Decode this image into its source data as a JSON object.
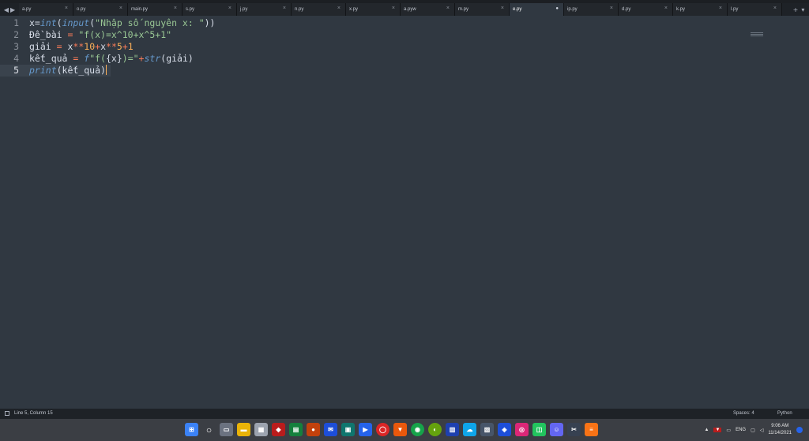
{
  "tabs": [
    {
      "label": "a.py",
      "active": false
    },
    {
      "label": "o.py",
      "active": false
    },
    {
      "label": "main.py",
      "active": false
    },
    {
      "label": "s.py",
      "active": false
    },
    {
      "label": "j.py",
      "active": false
    },
    {
      "label": "n.py",
      "active": false
    },
    {
      "label": "x.py",
      "active": false
    },
    {
      "label": "a.pyw",
      "active": false
    },
    {
      "label": "m.py",
      "active": false
    },
    {
      "label": "e.py",
      "active": true
    },
    {
      "label": "ip.py",
      "active": false
    },
    {
      "label": "d.py",
      "active": false
    },
    {
      "label": "k.py",
      "active": false
    },
    {
      "label": "l.py",
      "active": false
    }
  ],
  "code": {
    "line_numbers": [
      "1",
      "2",
      "3",
      "4",
      "5"
    ],
    "l1": {
      "a": "x=",
      "fn1": "int",
      "b": "(",
      "fn2": "input",
      "c": "(",
      "str": "\"Nhập số nguyên x: \"",
      "d": "))"
    },
    "l2": {
      "a": "Đề_bài ",
      "op": "=",
      "b": " ",
      "str": "\"f(x)=x^10+x^5+1\""
    },
    "l3": {
      "a": "giải ",
      "op1": "=",
      "b": " x",
      "op2": "**",
      "n1": "10",
      "op3": "+",
      "c": "x",
      "op4": "**",
      "n2": "5",
      "op5": "+",
      "n3": "1"
    },
    "l4": {
      "a": "kết_quả ",
      "op1": "=",
      "b": " ",
      "fn": "f",
      "str1": "\"f(",
      "c": "{x}",
      "str2": ")=\"",
      "op2": "+",
      "fn2": "str",
      "d": "(giải)"
    },
    "l5": {
      "fn": "print",
      "a": "(kết_quả)"
    }
  },
  "status": {
    "position": "Line 5, Column 15",
    "spaces": "Spaces: 4",
    "syntax": "Python"
  },
  "taskbar": {
    "language": "ENG",
    "time": "9:06 AM",
    "date": "11/14/2021"
  },
  "colors": {
    "editor_bg": "#303841",
    "function": "#6699cc",
    "string": "#99c794",
    "operator": "#f97b58",
    "number": "#f9ae58"
  }
}
